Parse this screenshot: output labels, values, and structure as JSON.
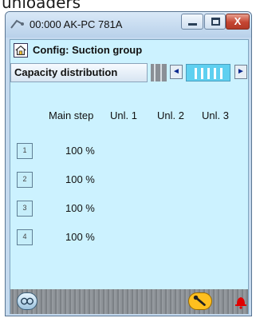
{
  "caption": "unloaders",
  "window": {
    "title": "00:000 AK-PC 781A",
    "min_icon": "minimize-icon",
    "max_icon": "maximize-icon",
    "close_icon": "close-icon",
    "close_glyph": "X"
  },
  "header": {
    "title": "Config: Suction group",
    "home_icon": "home-icon"
  },
  "tab": {
    "label": "Capacity distribution",
    "prev_glyph": "◄",
    "next_glyph": "►"
  },
  "table": {
    "columns": [
      "Main step",
      "Unl. 1",
      "Unl. 2",
      "Unl. 3"
    ],
    "rows": [
      {
        "step": "1",
        "value": "100 %"
      },
      {
        "step": "2",
        "value": "100 %"
      },
      {
        "step": "3",
        "value": "100 %"
      },
      {
        "step": "4",
        "value": "100 %"
      }
    ]
  },
  "footer": {
    "left_icon": "glasses-icon",
    "wrench_icon": "wrench-icon",
    "alarm_icon": "alarm-bell-icon"
  },
  "colors": {
    "content_bg": "#ccf2ff",
    "indicator": "#5fd0f0",
    "wrench": "#ffbf1f",
    "alarm": "#e00000"
  }
}
